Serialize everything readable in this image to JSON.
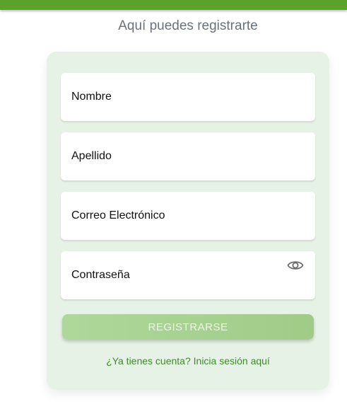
{
  "header": {
    "subtitle": "Aquí puedes registrarte",
    "bar_color": "#5aa22a"
  },
  "form": {
    "fields": [
      {
        "label": "Nombre"
      },
      {
        "label": "Apellido"
      },
      {
        "label": "Correo Electrónico"
      },
      {
        "label": "Contraseña",
        "icon": "eye-icon"
      }
    ],
    "submit_label": "REGISTRARSE",
    "login_link": "¿Ya tienes cuenta? Inicia sesión aquí"
  },
  "colors": {
    "card_bg": "#e6f2e6",
    "button": "#a7d291",
    "link": "#3f8a2c"
  }
}
